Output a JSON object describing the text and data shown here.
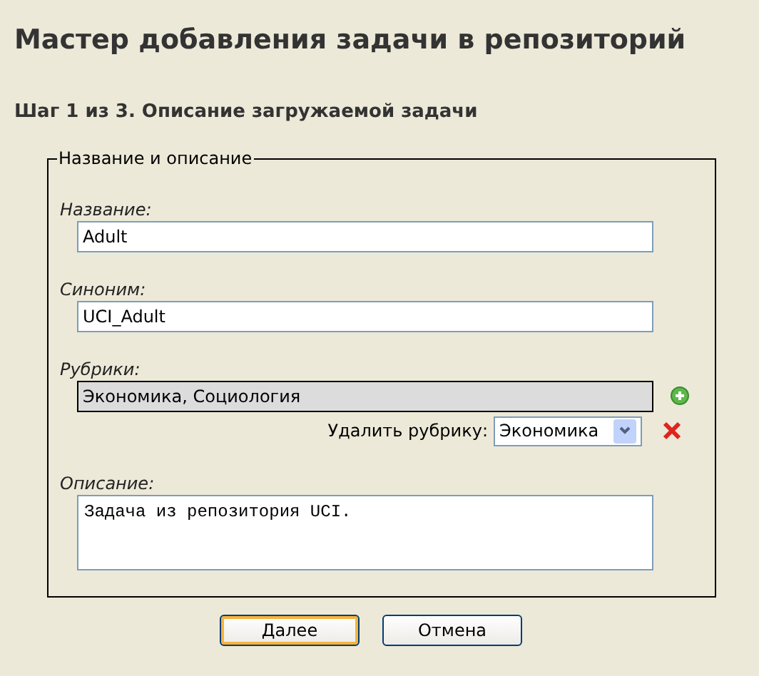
{
  "title": "Мастер добавления задачи в репозиторий",
  "step": "Шаг 1 из 3. Описание загружаемой задачи",
  "fieldset": {
    "legend": "Название и описание",
    "fields": [
      {
        "kind": "text",
        "label": "Название:",
        "value": "Adult"
      },
      {
        "kind": "text",
        "label": "Синоним:",
        "value": "UCI_Adult"
      },
      {
        "kind": "categories",
        "label": "Рубрики:",
        "value": "Экономика, Социология",
        "remove_label": "Удалить рубрику:",
        "remove_choice": "Экономика"
      },
      {
        "kind": "textarea",
        "label": "Описание:",
        "value": "Задача из репозитория UCI."
      }
    ]
  },
  "buttons": [
    {
      "label": "Далее",
      "focused": true
    },
    {
      "label": "Отмена",
      "focused": false
    }
  ]
}
